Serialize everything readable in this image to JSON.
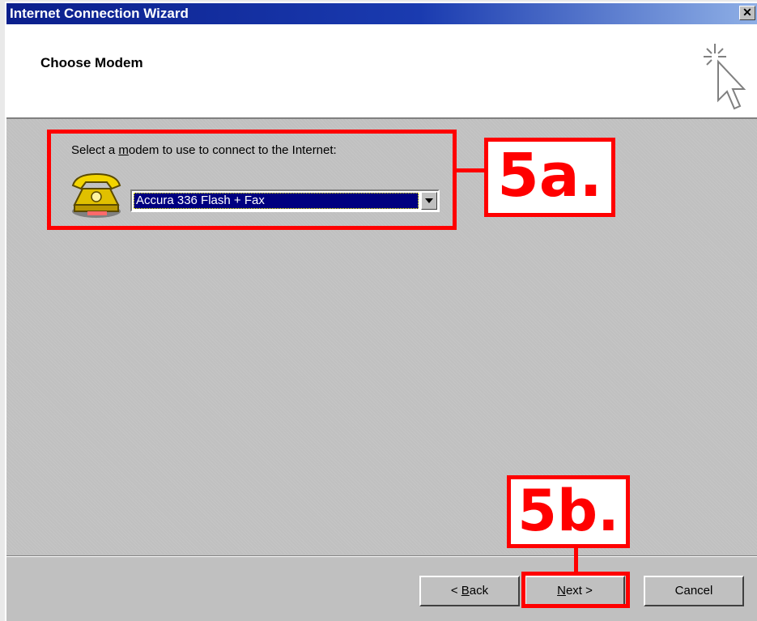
{
  "window": {
    "title": "Internet Connection Wizard",
    "close_glyph": "✕",
    "close_icon": "close-icon"
  },
  "header": {
    "page_title": "Choose Modem",
    "wizard_icon": "sparkle-cursor-icon"
  },
  "main": {
    "modem_label_pre": "Select a ",
    "modem_label_accel": "m",
    "modem_label_post": "odem to use to connect to the Internet:",
    "modem_selected": "Accura 336 Flash + Fax",
    "modem_icon": "telephone-modem-icon",
    "dropdown_icon": "chevron-down-icon"
  },
  "buttons": {
    "back_prefix": "< ",
    "back_accel": "B",
    "back_rest": "ack",
    "next_accel": "N",
    "next_rest": "ext >",
    "cancel": "Cancel"
  },
  "annotations": {
    "step_a": "5a.",
    "step_b": "5b.",
    "color": "#ff0000"
  },
  "colors": {
    "titlebar_start": "#0b1f8c",
    "titlebar_end": "#8fb0e6",
    "selection": "#000080",
    "dialog_face": "#c0c0c0"
  }
}
